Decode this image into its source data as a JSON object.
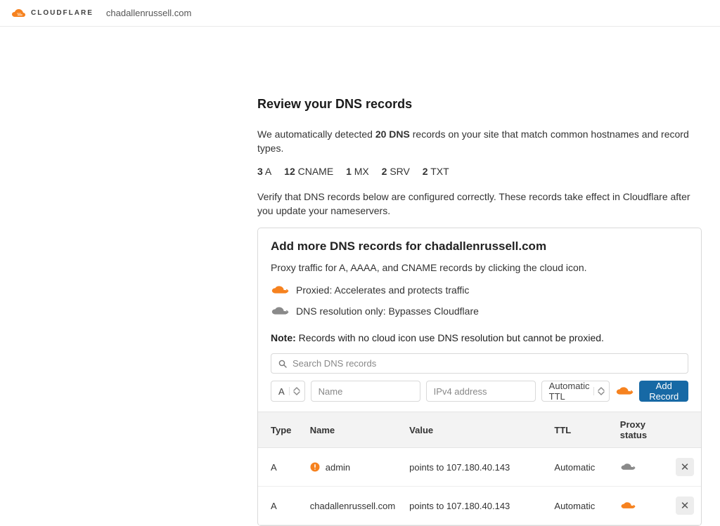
{
  "brand": {
    "name": "CLOUDFLARE"
  },
  "domain": "chadallenrussell.com",
  "page": {
    "title": "Review your DNS records",
    "intro_before": "We automatically detected ",
    "intro_count": "20 DNS",
    "intro_after": " records on your site that match common hostnames and record types.",
    "counts": [
      {
        "n": "3",
        "t": "A"
      },
      {
        "n": "12",
        "t": "CNAME"
      },
      {
        "n": "1",
        "t": "MX"
      },
      {
        "n": "2",
        "t": "SRV"
      },
      {
        "n": "2",
        "t": "TXT"
      }
    ],
    "verify": "Verify that DNS records below are configured correctly. These records take effect in Cloudflare after you update your nameservers."
  },
  "card": {
    "title": "Add more DNS records for chadallenrussell.com",
    "desc": "Proxy traffic for A, AAAA, and CNAME records by clicking the cloud icon.",
    "legend_proxied": "Proxied: Accelerates and protects traffic",
    "legend_dnsonly": "DNS resolution only: Bypasses Cloudflare",
    "note_label": "Note:",
    "note_text": " Records with no cloud icon use DNS resolution but cannot be proxied.",
    "search_placeholder": "Search DNS records",
    "add": {
      "type_value": "A",
      "name_placeholder": "Name",
      "value_placeholder": "IPv4 address",
      "ttl_value": "Automatic TTL",
      "button": "Add Record"
    }
  },
  "table": {
    "headers": {
      "type": "Type",
      "name": "Name",
      "value": "Value",
      "ttl": "TTL",
      "proxy": "Proxy status"
    },
    "rows": [
      {
        "type": "A",
        "name": "admin",
        "value": "points to 107.180.40.143",
        "ttl": "Automatic",
        "proxied": false,
        "alert": true
      },
      {
        "type": "A",
        "name": "chadallenrussell.com",
        "value": "points to 107.180.40.143",
        "ttl": "Automatic",
        "proxied": true,
        "alert": false
      }
    ]
  }
}
